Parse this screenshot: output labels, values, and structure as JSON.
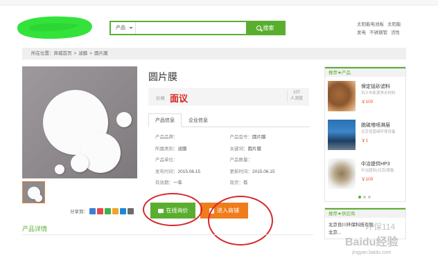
{
  "search": {
    "category": "产品",
    "button_label": "搜索"
  },
  "header": {
    "hot_words": [
      "太阳能电池板",
      "太阳能",
      "发电",
      "不锈钢管",
      "活性"
    ]
  },
  "breadcrumb": {
    "prefix": "所在位置：",
    "items": [
      "商城首页",
      "滤膜",
      "圆片膜"
    ],
    "separator": ">"
  },
  "product": {
    "title": "圆片膜",
    "price_label": "价格",
    "price_value": "面议",
    "review_count": "107",
    "review_label": "人浏览",
    "tabs": [
      "产品信息",
      "企业信息"
    ],
    "attributes": [
      [
        {
          "k": "产品品牌：",
          "v": ""
        },
        {
          "k": "产品型号：",
          "v": "圆片膜"
        }
      ],
      [
        {
          "k": "所属类别：",
          "v": "滤膜"
        },
        {
          "k": "关键词：",
          "v": "圆片膜"
        }
      ],
      [
        {
          "k": "产品单位：",
          "v": ""
        },
        {
          "k": "产品数量：",
          "v": ""
        }
      ],
      [
        {
          "k": "发布时间：",
          "v": "2015.06.15"
        },
        {
          "k": "更新时间：",
          "v": "2015.06.15"
        }
      ],
      [
        {
          "k": "有效期：",
          "v": "一年"
        },
        {
          "k": "现货：",
          "v": "有"
        }
      ]
    ],
    "share_label": "分享到：",
    "inquiry_label": "在线询价",
    "shop_label": "进入商铺"
  },
  "detail": {
    "title": "产品详情"
  },
  "sidebar": {
    "title": "推荐★产品",
    "items": [
      {
        "name": "保定锰砂滤料",
        "sub": "巩义市凯源净水材料",
        "price": "￥100"
      },
      {
        "name": "脱硫塔喷淋层",
        "sub": "北京佳蓝绿环保设备",
        "price": "￥1"
      },
      {
        "name": "中冶提供HP3",
        "sub": "中冶国际(北京)销售",
        "price": "￥100"
      }
    ],
    "supplier_title": "推荐★供应商",
    "supplier_name": "北京良川环保科技有限",
    "supplier_sub": "北京..."
  },
  "watermark": {
    "brand": "环保114",
    "site": "Baidu经验",
    "url": "jingyan.baidu.com"
  },
  "colors": {
    "accent_green": "#5aae2f",
    "accent_orange": "#f07c1c",
    "price_red": "#d9241c",
    "annotation_red": "#d7262a"
  }
}
